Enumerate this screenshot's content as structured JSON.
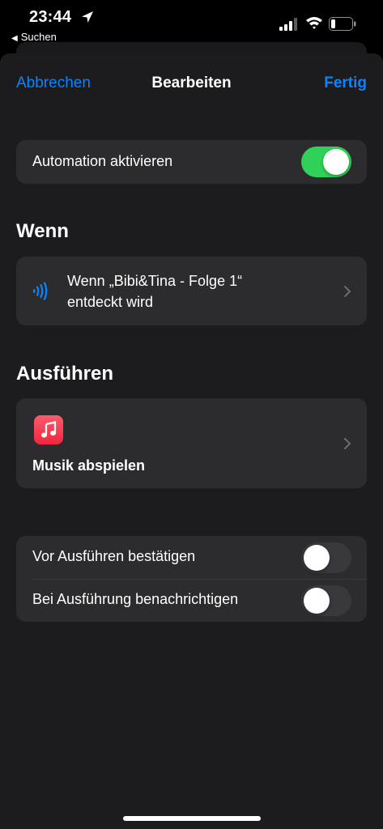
{
  "status": {
    "time": "23:44",
    "back_app": "Suchen",
    "back_arrow": "◀"
  },
  "nav": {
    "cancel": "Abbrechen",
    "title": "Bearbeiten",
    "done": "Fertig"
  },
  "automation": {
    "label": "Automation aktivieren",
    "enabled": true
  },
  "when": {
    "section_title": "Wenn",
    "trigger_line1": "Wenn „Bibi&Tina - Folge 1“",
    "trigger_line2": "entdeckt wird",
    "icon": "nfc-icon"
  },
  "execute": {
    "section_title": "Ausführen",
    "action_label": "Musik abspielen",
    "icon": "music-app-icon"
  },
  "options": [
    {
      "label": "Vor Ausführen bestätigen",
      "enabled": false
    },
    {
      "label": "Bei Ausführung benachrichtigen",
      "enabled": false
    }
  ],
  "colors": {
    "accent": "#0a84ff",
    "toggle_on": "#30d158",
    "music_red": "#fa2d48"
  }
}
